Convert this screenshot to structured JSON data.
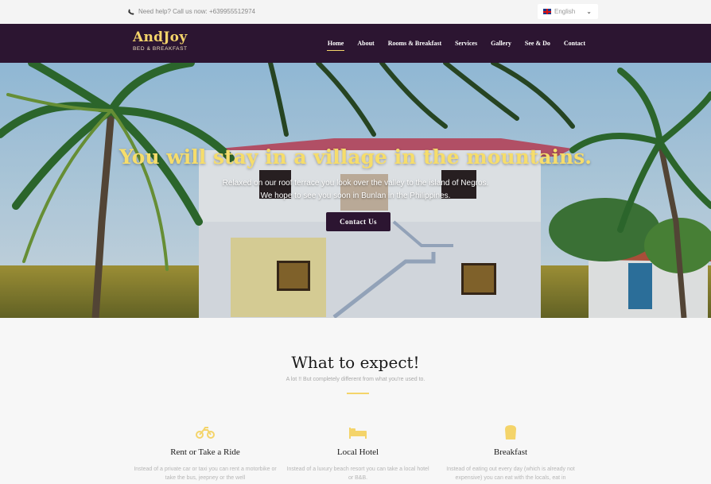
{
  "topbar": {
    "phone_text": "Need help? Call us now: +639955512974",
    "language": "English"
  },
  "nav": {
    "logo_title": "AndJoy",
    "logo_subtitle": "BED & BREAKFAST",
    "items": [
      "Home",
      "About",
      "Rooms & Breakfast",
      "Services",
      "Gallery",
      "See & Do",
      "Contact"
    ],
    "active": "Home"
  },
  "hero": {
    "title": "You will stay in a village in the mountains.",
    "line1": "Relaxed on our roof terrace you look over the valley to the island of Negros.",
    "line2": "We hope to see you soon in Bunlan in the Philippines.",
    "cta": "Contact Us"
  },
  "expect": {
    "title": "What to expect!",
    "subtitle": "A lot !! But completely different from what you're used to.",
    "features": [
      {
        "icon": "motorbike-icon",
        "title": "Rent or Take a Ride",
        "text": "Instead of a private car or taxi you can rent a motorbike or take the bus, jeepney or the well"
      },
      {
        "icon": "bed-icon",
        "title": "Local Hotel",
        "text": "Instead of a luxury beach resort you can take a local hotel or B&B."
      },
      {
        "icon": "breakfast-icon",
        "title": "Breakfast",
        "text": "Instead of eating out every day (which is already not expensive) you can eat with the locals, eat in"
      }
    ]
  },
  "colors": {
    "brand_purple": "#2c1531",
    "accent_gold": "#f4d46a"
  }
}
